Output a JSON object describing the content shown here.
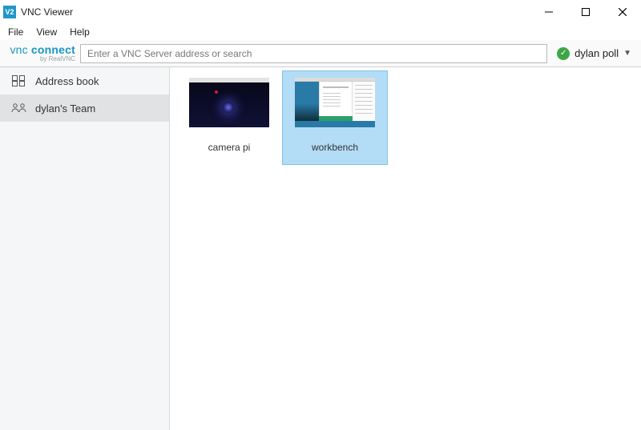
{
  "window": {
    "title": "VNC Viewer",
    "icon_text": "V2"
  },
  "menu": {
    "file": "File",
    "view": "View",
    "help": "Help"
  },
  "toolbar": {
    "logo_main": "connect",
    "logo_prefix": "vnc",
    "logo_sub": "by RealVNC",
    "search_placeholder": "Enter a VNC Server address or search",
    "user_name": "dylan poll"
  },
  "sidebar": {
    "items": [
      {
        "label": "Address book",
        "selected": false,
        "icon": "address-book-icon"
      },
      {
        "label": "dylan's Team",
        "selected": true,
        "icon": "team-icon"
      }
    ]
  },
  "connections": [
    {
      "label": "camera pi",
      "selected": false,
      "thumb_kind": "dark"
    },
    {
      "label": "workbench",
      "selected": true,
      "thumb_kind": "desk"
    }
  ]
}
